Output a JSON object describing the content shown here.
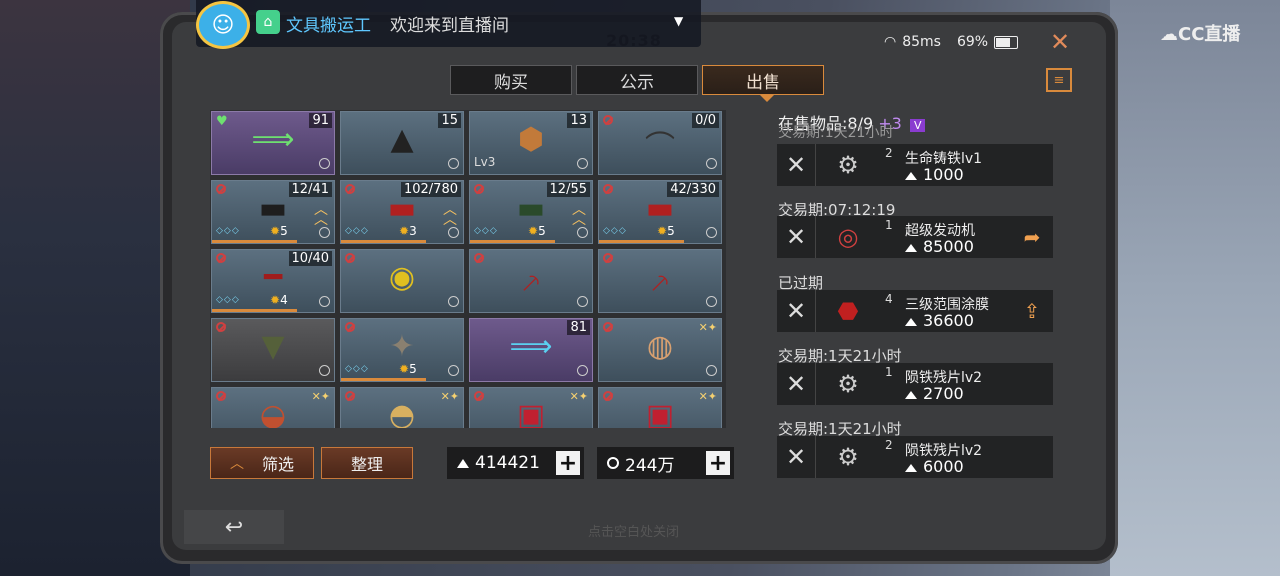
{
  "stream": {
    "name": "文具搬运工",
    "welcome": "欢迎来到直播间",
    "brand": "CC直播"
  },
  "status": {
    "time": "20:38",
    "ping": "85ms",
    "battery": "69%"
  },
  "tabs": [
    {
      "label": "购买",
      "active": false
    },
    {
      "label": "公示",
      "active": false
    },
    {
      "label": "出售",
      "active": true
    }
  ],
  "inventory": [
    {
      "qty": "91",
      "style": "purple",
      "icon": "heal-injector-green",
      "badge": "heart"
    },
    {
      "qty": "15",
      "style": "blue",
      "icon": "gunpowder-pile"
    },
    {
      "qty": "13",
      "style": "blue",
      "icon": "copper-ingot",
      "level": "Lv3"
    },
    {
      "qty": "0/0",
      "style": "blue",
      "icon": "fishing-rod",
      "banned": true
    },
    {
      "qty": "12/41",
      "style": "blue",
      "icon": "assault-rifle-black",
      "banned": true,
      "stars": "5",
      "upgrade": true
    },
    {
      "qty": "102/780",
      "style": "blue",
      "icon": "machine-gun-red",
      "banned": true,
      "stars": "3",
      "upgrade": true
    },
    {
      "qty": "12/55",
      "style": "blue",
      "icon": "assault-rifle-green",
      "banned": true,
      "stars": "5",
      "upgrade": true
    },
    {
      "qty": "42/330",
      "style": "blue",
      "icon": "assault-rifle-red",
      "banned": true,
      "stars": "5"
    },
    {
      "qty": "10/40",
      "style": "blue",
      "icon": "sniper-rifle-red",
      "banned": true,
      "stars": "4"
    },
    {
      "qty": "",
      "style": "blue",
      "icon": "chainsaw-yellow",
      "banned": true
    },
    {
      "qty": "",
      "style": "blue",
      "icon": "pickaxe-red",
      "banned": true
    },
    {
      "qty": "",
      "style": "blue",
      "icon": "pickaxe-red-2",
      "banned": true
    },
    {
      "qty": "",
      "style": "gray",
      "icon": "armor-vest-green",
      "banned": true
    },
    {
      "qty": "",
      "style": "blue",
      "icon": "exo-skeleton",
      "banned": true,
      "stars": "5"
    },
    {
      "qty": "81",
      "style": "purple",
      "icon": "heal-injector-blue"
    },
    {
      "qty": "",
      "style": "blue",
      "icon": "food-platter",
      "banned": true,
      "food": true
    },
    {
      "qty": "",
      "style": "blue",
      "icon": "food-bowl",
      "banned": true,
      "food": true
    },
    {
      "qty": "",
      "style": "blue",
      "icon": "food-fish",
      "banned": true,
      "food": true
    },
    {
      "qty": "",
      "style": "blue",
      "icon": "food-snack",
      "banned": true,
      "food": true
    },
    {
      "qty": "",
      "style": "blue",
      "icon": "food-snack-2",
      "banned": true,
      "food": true
    }
  ],
  "buttons": {
    "filter": "筛选",
    "sort": "整理"
  },
  "currency": {
    "iron": "414421",
    "gold": "244万"
  },
  "listing_header": {
    "label": "在售物品:8/9",
    "extra": "+3",
    "vip": "V"
  },
  "listings": [
    {
      "period": "交易期:1天21小时",
      "count": "2",
      "name": "生命铸铁lv1",
      "price": "1000",
      "action": ""
    },
    {
      "period": "交易期:07:12:19",
      "count": "1",
      "name": "超级发动机",
      "price": "85000",
      "action": "share"
    },
    {
      "period": "已过期",
      "count": "4",
      "name": "三级范围涂膜",
      "price": "36600",
      "action": "relist"
    },
    {
      "period": "交易期:1天21小时",
      "count": "1",
      "name": "陨铁残片lv2",
      "price": "2700",
      "action": ""
    },
    {
      "period": "交易期:1天21小时",
      "count": "2",
      "name": "陨铁残片lv2",
      "price": "6000",
      "action": ""
    }
  ],
  "footer": {
    "close_hint": "点击空白处关闭"
  },
  "colors": {
    "accent": "#d98a3c",
    "tab_active_border": "#d98a3c",
    "purple_slot": "#6e5a8c",
    "blue_slot": "#5c7080"
  }
}
